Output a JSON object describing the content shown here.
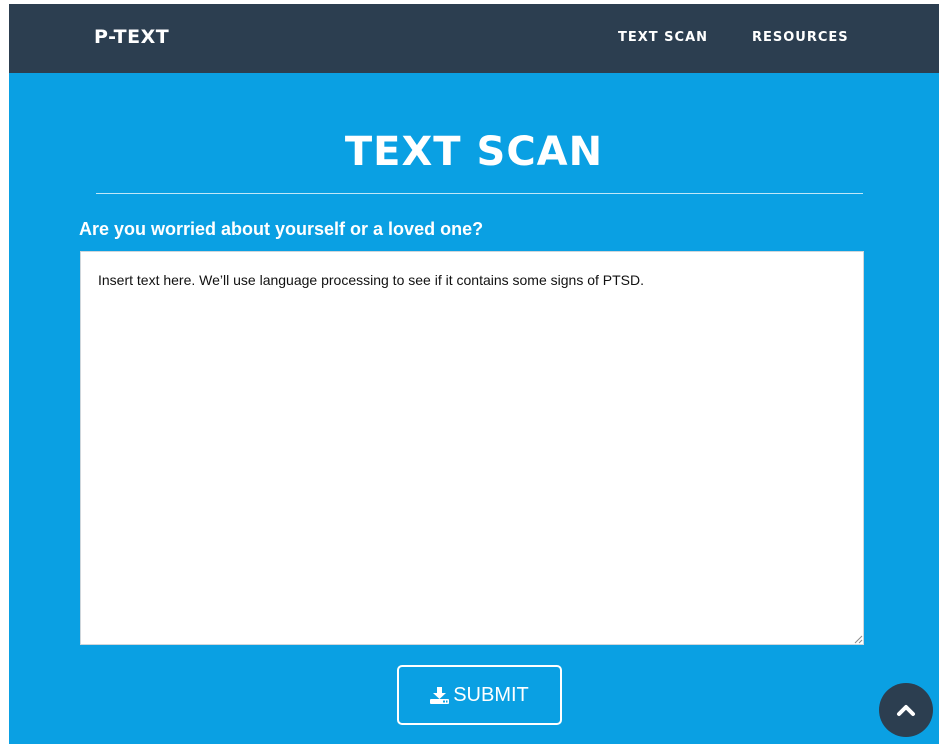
{
  "navbar": {
    "brand": "P-TEXT",
    "links": [
      {
        "label": "TEXT SCAN"
      },
      {
        "label": "RESOURCES"
      }
    ]
  },
  "main": {
    "title": "TEXT SCAN",
    "question": "Are you worried about yourself or a loved one?",
    "textarea": {
      "placeholder": "Insert text here. We’ll use language processing to see if it contains some signs of PTSD.",
      "value": ""
    },
    "submit_label": "SUBMIT",
    "submit_icon": "download-icon"
  },
  "scroll_top": {
    "icon": "chevron-up-icon"
  },
  "colors": {
    "navbar_bg": "#2c3e50",
    "page_bg": "#0aa0e3",
    "text": "#ffffff"
  }
}
